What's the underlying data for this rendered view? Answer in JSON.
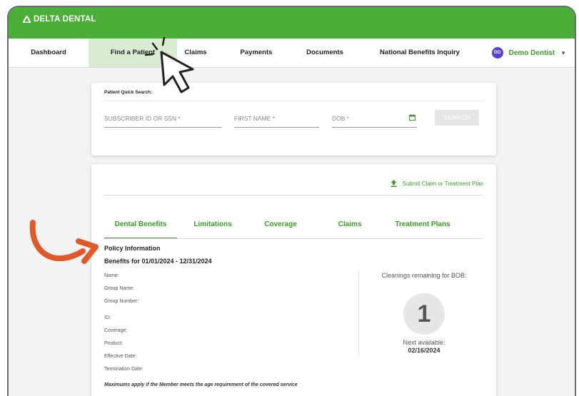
{
  "brand": {
    "name": "DELTA DENTAL",
    "primary_color": "#4aae38",
    "accent_color": "#3c9a2a"
  },
  "nav": {
    "items": [
      {
        "label": "Dashboard"
      },
      {
        "label": "Find a Patient",
        "active": true
      },
      {
        "label": "Claims"
      },
      {
        "label": "Payments"
      },
      {
        "label": "Documents"
      },
      {
        "label": "National Benefits Inquiry"
      }
    ],
    "user": {
      "initials": "DD",
      "name": "Demo Dentist"
    }
  },
  "quick_search": {
    "label": "Patient Quick Search:",
    "subscriber_placeholder": "SUBSCRIBER ID OR SSN *",
    "first_name_placeholder": "FIRST NAME *",
    "dob_placeholder": "DOB *",
    "search_button": "SEARCH"
  },
  "patient": {
    "submit_link": "Submit Claim or Treatment Plan",
    "tabs": [
      "Dental Benefits",
      "Limitations",
      "Coverage",
      "Claims",
      "Treatment Plans"
    ],
    "active_tab": "Dental Benefits",
    "policy_title": "Policy Information",
    "benefits_title": "Benefits for 01/01/2024 - 12/31/2024",
    "fields": [
      "Name:",
      "Group Name:",
      "Group Number:",
      "ID:",
      "Coverage:",
      "Product:",
      "Effective Date:",
      "Termination Date:"
    ],
    "cleanings_label": "Cleanings remaining for BOB:",
    "cleanings_count": "1",
    "next_available_label": "Next available:",
    "next_available_date": "02/16/2024",
    "footnote": "Maximums apply if the Member meets the age requirement of the covered service"
  },
  "icons": [
    "delta-logo-icon",
    "calendar-icon",
    "upload-icon",
    "chevron-down-icon",
    "cursor-pointer-icon",
    "curved-arrow-icon"
  ]
}
